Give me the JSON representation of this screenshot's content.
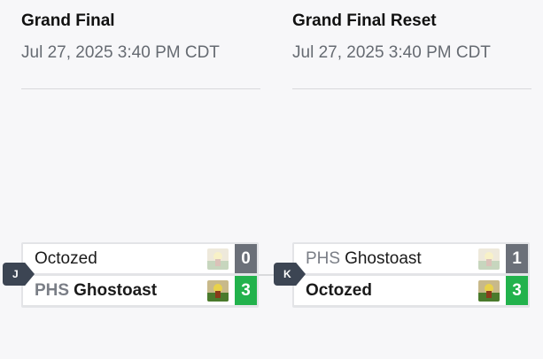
{
  "rounds": [
    {
      "title": "Grand Final",
      "date": "Jul 27, 2025 3:40 PM CDT",
      "match_label": "J",
      "slots": [
        {
          "tag": "",
          "name": "Octozed",
          "score": "0",
          "winner": false
        },
        {
          "tag": "PHS",
          "name": "Ghostoast",
          "score": "3",
          "winner": true
        }
      ]
    },
    {
      "title": "Grand Final Reset",
      "date": "Jul 27, 2025 3:40 PM CDT",
      "match_label": "K",
      "slots": [
        {
          "tag": "PHS",
          "name": "Ghostoast",
          "score": "1",
          "winner": false
        },
        {
          "tag": "",
          "name": "Octozed",
          "score": "3",
          "winner": true
        }
      ]
    }
  ],
  "colors": {
    "win_score": "#22b24c",
    "lose_score": "#6b7079",
    "badge": "#3c4553"
  },
  "icons": {
    "avatar": "player-avatar-icon"
  }
}
